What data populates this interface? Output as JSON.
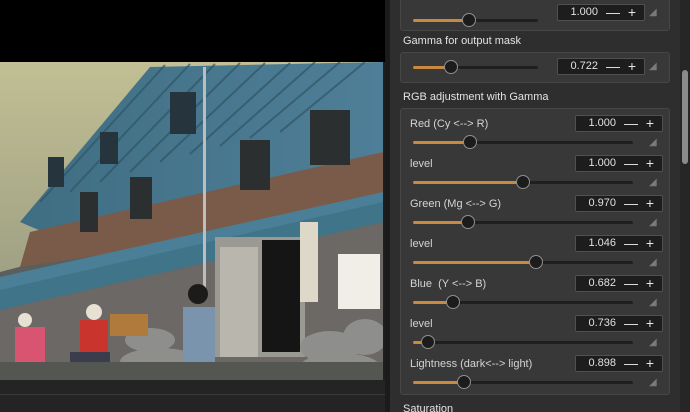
{
  "panel": {
    "top_row": {
      "value": "1.000",
      "level": 0.29
    },
    "gamma_output_mask": {
      "title": "Gamma for output mask",
      "value": "0.722",
      "level": 0.22
    },
    "rgb_gamma": {
      "title": "RGB adjustment with Gamma",
      "rows": [
        {
          "label": "Red (Cy <--> R)",
          "value": "1.000",
          "level": 0.26
        },
        {
          "label": "level",
          "value": "1.000",
          "level": 0.5
        },
        {
          "label": "Green (Mg <--> G)",
          "value": "0.970",
          "level": 0.25
        },
        {
          "label": "level",
          "value": "1.046",
          "level": 0.56
        },
        {
          "label": "Blue  (Y <--> B)",
          "value": "0.682",
          "level": 0.18
        },
        {
          "label": "level",
          "value": "0.736",
          "level": 0.07
        },
        {
          "label": "Lightness (dark<--> light)",
          "value": "0.898",
          "level": 0.23
        }
      ]
    },
    "saturation": {
      "title": "Saturation"
    }
  },
  "icons": {
    "minus": "—",
    "plus": "+",
    "reset": "◢"
  },
  "colors": {
    "accent": "#c98a40",
    "panel_bg": "#2e2e2e",
    "group_bg": "#383838"
  }
}
